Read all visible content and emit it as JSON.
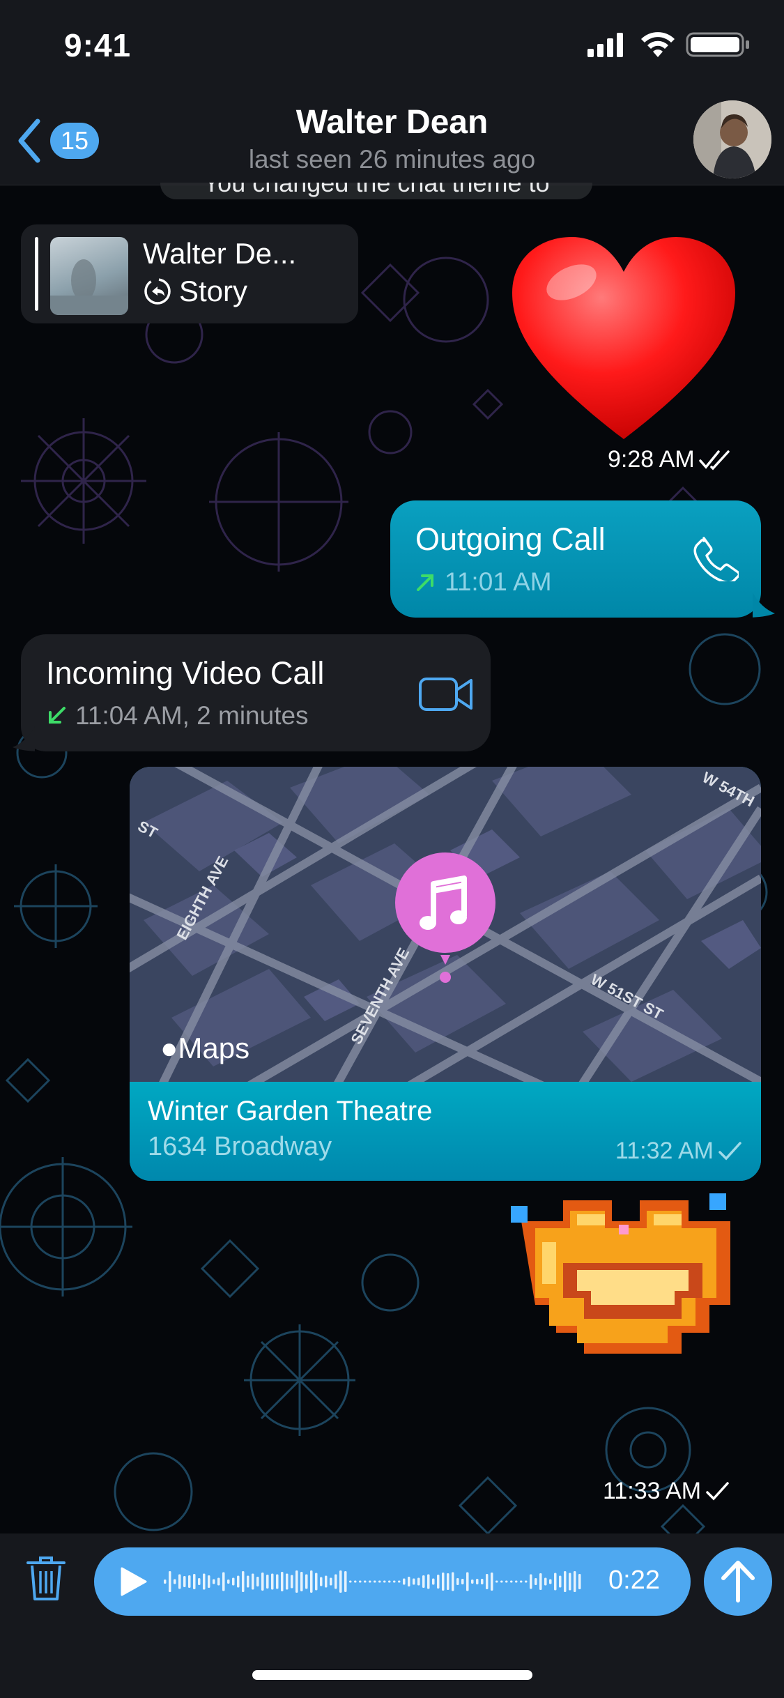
{
  "status": {
    "time": "9:41"
  },
  "nav": {
    "back_count": "15",
    "title": "Walter Dean",
    "subtitle": "last seen 26 minutes ago"
  },
  "messages": {
    "service": "You changed the chat theme to",
    "story_reply": {
      "name": "Walter De...",
      "label": "Story"
    },
    "heart_time": "9:28 AM",
    "outgoing_call": {
      "title": "Outgoing Call",
      "time": "11:01 AM"
    },
    "incoming_call": {
      "title": "Incoming Video Call",
      "detail": "11:04 AM, 2 minutes"
    },
    "location": {
      "name": "Winter Garden Theatre",
      "address": "1634 Broadway",
      "time": "11:32 AM",
      "map_brand": "Maps",
      "streets": [
        "EIGHTH AVE",
        "SEVENTH AVE",
        "W 51ST ST",
        "W 54TH",
        "ST"
      ]
    },
    "sticker_time": "11:33 AM"
  },
  "input": {
    "voice_duration": "0:22"
  },
  "colors": {
    "accent": "#4ea8f0",
    "outgoing_bubble": "#0096b5",
    "incoming_bubble": "#1c1e23",
    "bar": "#16181d",
    "pin": "#e070d8"
  },
  "icons": [
    "chevron-left-icon",
    "phone-icon",
    "video-camera-icon",
    "music-note-icon",
    "trash-icon",
    "play-icon",
    "arrow-up-icon",
    "reply-story-icon",
    "double-check-icon",
    "check-icon"
  ]
}
